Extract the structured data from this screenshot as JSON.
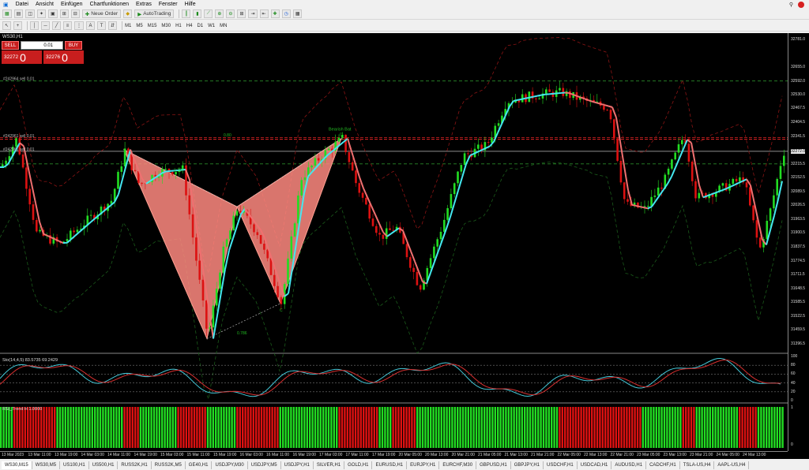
{
  "menu": [
    "Datei",
    "Ansicht",
    "Einfügen",
    "Chartfunktionen",
    "Extras",
    "Fenster",
    "Hilfe"
  ],
  "toolbar": {
    "new_order_label": "Neue Order",
    "autotrading_label": "AutoTrading",
    "timeframes": [
      "M1",
      "M5",
      "M15",
      "M30",
      "H1",
      "H4",
      "D1",
      "W1",
      "MN"
    ]
  },
  "chart": {
    "symbol_title": "WS30,H1",
    "trade_panel": {
      "sell_label": "SELL",
      "buy_label": "BUY",
      "lot": "0.01",
      "sell_price_prefix": "32272",
      "sell_price_big": "0",
      "buy_price_prefix": "32276",
      "buy_price_big": "0"
    },
    "order_labels": [
      "#242964 sell 0.01",
      "#242961 sell 0.01",
      "#242961 sell 0.01"
    ],
    "pattern": {
      "label": "Bearish Bat",
      "point_d": "D",
      "point_c": "C",
      "ratio_a": "0.786",
      "ratio_b": "0.80",
      "ratio_c": "0.787"
    },
    "y_ticks": [
      "32781.0",
      "32655.0",
      "32592.0",
      "32530.0",
      "32467.5",
      "32404.5",
      "32341.5",
      "32272.0",
      "32215.5",
      "32152.5",
      "32089.5",
      "32026.5",
      "31963.5",
      "31900.5",
      "31837.5",
      "31774.5",
      "31711.5",
      "31648.5",
      "31585.5",
      "31522.5",
      "31459.5",
      "31396.5"
    ],
    "current_price": "32272.0",
    "stoch": {
      "label": "Sto(14,4,5) 83.5735 69.2429",
      "ticks": [
        "100",
        "80",
        "60",
        "40",
        "20",
        "0"
      ]
    },
    "trend": {
      "label": "RSI_Trend H 1.0000",
      "ticks": [
        "1",
        "0"
      ]
    },
    "x_ticks": [
      "13 Mar 2023",
      "13 Mar 11:00",
      "13 Mar 19:00",
      "14 Mar 03:00",
      "14 Mar 11:00",
      "14 Mar 19:00",
      "15 Mar 03:00",
      "15 Mar 11:00",
      "15 Mar 19:00",
      "16 Mar 03:00",
      "16 Mar 11:00",
      "16 Mar 19:00",
      "17 Mar 03:00",
      "17 Mar 11:00",
      "17 Mar 19:00",
      "20 Mar 05:00",
      "20 Mar 13:00",
      "20 Mar 21:00",
      "21 Mar 05:00",
      "21 Mar 13:00",
      "21 Mar 21:00",
      "22 Mar 05:00",
      "22 Mar 13:00",
      "22 Mar 21:00",
      "23 Mar 05:00",
      "23 Mar 13:00",
      "23 Mar 21:00",
      "24 Mar 05:00",
      "24 Mar 13:00"
    ]
  },
  "tabs": [
    "WS30,M15",
    "WS30,M5",
    "US100,H1",
    "US500,H1",
    "RUSS2K,H1",
    "RUSS2K,M5",
    "GE40,H1",
    "USDJPY,M30",
    "USDJPY,M5",
    "USDJPY,H1",
    "SILVER,H1",
    "GOLD,H1",
    "EURUSD,H1",
    "EURJPY,H1",
    "EURCHF,M30",
    "GBPUSD,H1",
    "GBPJPY,H1",
    "USDCHF,H1",
    "USDCAD,H1",
    "AUDUSD,H1",
    "CADCHF,H1",
    "TSLA-US,H4",
    "AAPL-US,H4"
  ],
  "colors": {
    "bull": "#22dd22",
    "bear": "#dd1111",
    "ma_up": "#44e8f0",
    "ma_down": "#f07070",
    "pattern_fill": "#ff8a80"
  }
}
